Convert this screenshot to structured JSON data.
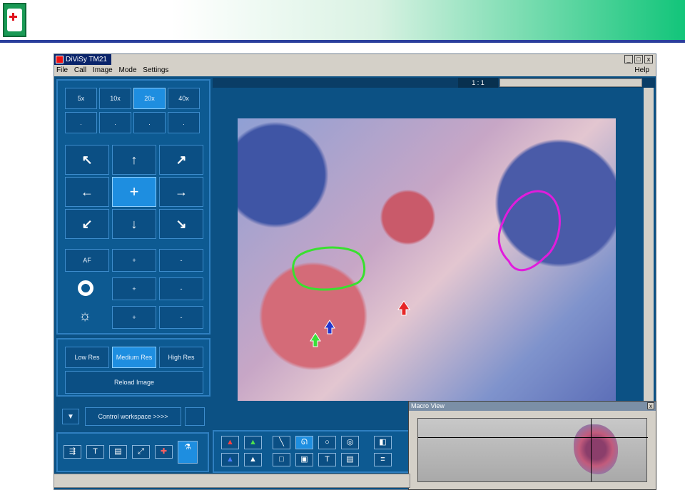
{
  "window": {
    "title": "DiViSy TM21",
    "min": "_",
    "max": "□",
    "close": "x"
  },
  "menu": {
    "items": [
      "File",
      "Call",
      "Image",
      "Mode",
      "Settings"
    ],
    "help": "Help"
  },
  "magnification": {
    "buttons": [
      "5x",
      "10x",
      "20x",
      "40x"
    ],
    "selected": "20x",
    "presets": [
      ".",
      ".",
      ".",
      "."
    ]
  },
  "focus": {
    "af": "AF",
    "plus": "+",
    "minus": "-"
  },
  "resolution": {
    "low": "Low Res",
    "medium": "Medium Res",
    "high": "High Res",
    "selected": "Medium Res",
    "reload": "Reload Image"
  },
  "workspace": {
    "control": "Control workspace >>>>"
  },
  "viewer": {
    "scale": "1 : 1"
  },
  "macro": {
    "title": "Macro View",
    "close": "x"
  },
  "icons": [
    "arrow-nw-icon",
    "arrow-up-icon",
    "arrow-ne-icon",
    "arrow-left-icon",
    "crosshair-icon",
    "arrow-right-icon",
    "arrow-sw-icon",
    "arrow-down-icon",
    "arrow-se-icon",
    "aperture-icon",
    "brightness-icon"
  ],
  "colors": {
    "banner_accent": "#12c57a",
    "panel": "#0d5a92",
    "selected": "#1e8ee0"
  }
}
